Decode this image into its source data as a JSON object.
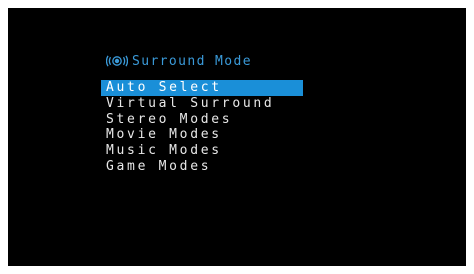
{
  "colors": {
    "screen_background": "#000000",
    "title_color": "#3a9ad9",
    "selection_highlight": "#1a8fd8",
    "item_text": "#e8e8e8"
  },
  "header": {
    "icon": "surround-sound-icon",
    "title": "Surround Mode"
  },
  "menu": {
    "selected_index": 0,
    "items": [
      {
        "label": "Auto Select"
      },
      {
        "label": "Virtual Surround"
      },
      {
        "label": "Stereo Modes"
      },
      {
        "label": "Movie Modes"
      },
      {
        "label": "Music Modes"
      },
      {
        "label": "Game Modes"
      }
    ]
  }
}
